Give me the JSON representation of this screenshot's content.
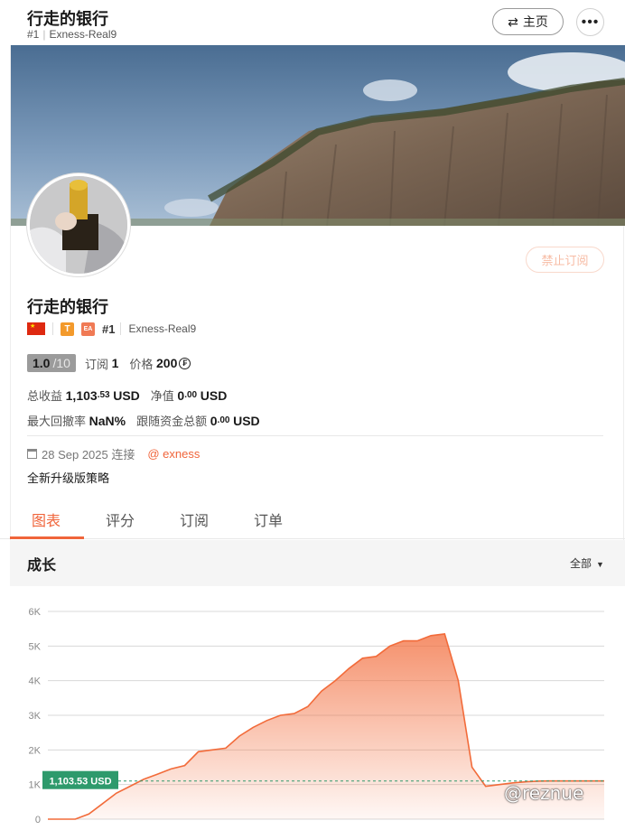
{
  "header": {
    "title": "行走的银行",
    "rank": "#1",
    "server": "Exness-Real9",
    "home_label": "主页",
    "more_label": "•••"
  },
  "profile": {
    "unsubscribe_label": "禁止订阅",
    "name": "行走的银行",
    "badge_t": "T",
    "badge_ea": "EA",
    "rank": "#1",
    "server": "Exness-Real9",
    "score": "1.0",
    "score_max": "/10",
    "subs_label": "订阅",
    "subs_value": "1",
    "price_label": "价格",
    "price_value": "200",
    "price_coin": "₣",
    "total_profit_label": "总收益",
    "total_profit_int": "1,103",
    "total_profit_dec": ".53",
    "total_profit_unit": "USD",
    "equity_label": "净值",
    "equity_int": "0",
    "equity_dec": ".00",
    "equity_unit": "USD",
    "max_dd_label": "最大回撤率",
    "max_dd_value": "NaN%",
    "follow_funds_label": "跟随资金总额",
    "follow_funds_int": "0",
    "follow_funds_dec": ".00",
    "follow_funds_unit": "USD",
    "created_date": "28 Sep 2025 连接",
    "broker_link": "@ exness",
    "description": "全新升级版策略"
  },
  "tabs": [
    {
      "label": "图表",
      "active": true
    },
    {
      "label": "评分",
      "active": false
    },
    {
      "label": "订阅",
      "active": false
    },
    {
      "label": "订单",
      "active": false
    }
  ],
  "growth": {
    "title": "成长",
    "range_select": "全部"
  },
  "chart_data": {
    "type": "area",
    "y_ticks": [
      "0",
      "1K",
      "2K",
      "3K",
      "4K",
      "5K",
      "6K"
    ],
    "ylim": [
      0,
      6000
    ],
    "current_label": "1,103.53 USD",
    "current_value": 1103.53,
    "x": [
      0,
      3,
      6,
      9,
      12,
      15,
      18,
      21,
      24,
      27,
      30,
      33,
      36,
      39,
      42,
      45,
      48,
      51,
      54,
      57,
      60,
      63,
      66,
      69,
      72,
      75,
      78,
      81,
      84,
      87,
      90,
      93,
      96,
      99,
      102,
      105,
      108,
      110,
      112,
      114,
      116,
      118,
      120,
      122
    ],
    "values": [
      0,
      0,
      0,
      150,
      450,
      750,
      950,
      1150,
      1300,
      1450,
      1550,
      1950,
      2000,
      2050,
      2400,
      2650,
      2850,
      3000,
      3050,
      3250,
      3700,
      4000,
      4350,
      4650,
      4700,
      5000,
      5150,
      5150,
      5300,
      5350,
      4000,
      1500,
      950,
      1000,
      1050,
      1080,
      1100,
      1103,
      1103,
      1103,
      1103,
      1103,
      1103,
      1103
    ],
    "color": "#f26b3a",
    "grid": true
  },
  "watermark": "@reznue",
  "colors": {
    "accent": "#f0653b",
    "current_tag": "#2e9a6c",
    "score_bg": "#9b9b9b"
  }
}
